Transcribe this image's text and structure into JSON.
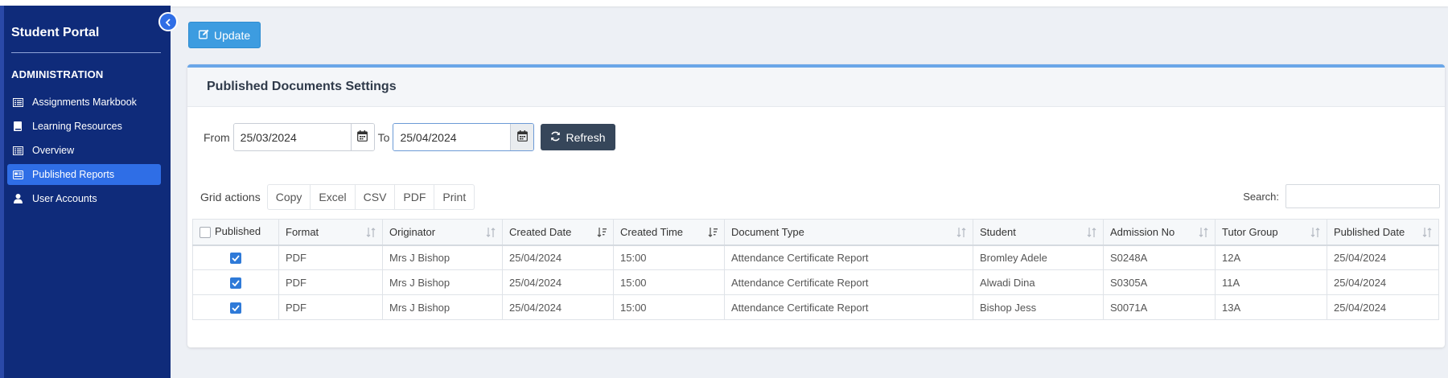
{
  "sidebar": {
    "brand": "Student Portal",
    "section_title": "ADMINISTRATION",
    "items": [
      {
        "label": "Assignments Markbook",
        "icon": "list-icon",
        "active": false
      },
      {
        "label": "Learning Resources",
        "icon": "book-icon",
        "active": false
      },
      {
        "label": "Overview",
        "icon": "list-icon",
        "active": false
      },
      {
        "label": "Published Reports",
        "icon": "newspaper-icon",
        "active": true
      },
      {
        "label": "User Accounts",
        "icon": "user-icon",
        "active": false
      }
    ]
  },
  "toolbar": {
    "update_label": "Update"
  },
  "card": {
    "title": "Published Documents Settings",
    "filter": {
      "from_label": "From",
      "from_value": "25/03/2024",
      "to_label": "To",
      "to_value": "25/04/2024",
      "refresh_label": "Refresh"
    },
    "grid_actions": {
      "label": "Grid actions",
      "buttons": [
        "Copy",
        "Excel",
        "CSV",
        "PDF",
        "Print"
      ]
    },
    "search_label": "Search:",
    "search_value": ""
  },
  "table": {
    "columns": [
      "Published",
      "Format",
      "Originator",
      "Created Date",
      "Created Time",
      "Document Type",
      "Student",
      "Admission No",
      "Tutor Group",
      "Published Date"
    ],
    "rows": [
      {
        "published": true,
        "format": "PDF",
        "originator": "Mrs J Bishop",
        "created_date": "25/04/2024",
        "created_time": "15:00",
        "document_type": "Attendance Certificate Report",
        "student": "Bromley Adele",
        "admission_no": "S0248A",
        "tutor_group": "12A",
        "published_date": "25/04/2024"
      },
      {
        "published": true,
        "format": "PDF",
        "originator": "Mrs J Bishop",
        "created_date": "25/04/2024",
        "created_time": "15:00",
        "document_type": "Attendance Certificate Report",
        "student": "Alwadi Dina",
        "admission_no": "S0305A",
        "tutor_group": "11A",
        "published_date": "25/04/2024"
      },
      {
        "published": true,
        "format": "PDF",
        "originator": "Mrs J Bishop",
        "created_date": "25/04/2024",
        "created_time": "15:00",
        "document_type": "Attendance Certificate Report",
        "student": "Bishop Jess",
        "admission_no": "S0071A",
        "tutor_group": "13A",
        "published_date": "25/04/2024"
      }
    ]
  },
  "colors": {
    "sidebar_bg": "#0f2b7a",
    "accent": "#2f6ee6",
    "update_button": "#3d9ce0",
    "refresh_button": "#36465a",
    "checkbox": "#2f7ad8"
  }
}
